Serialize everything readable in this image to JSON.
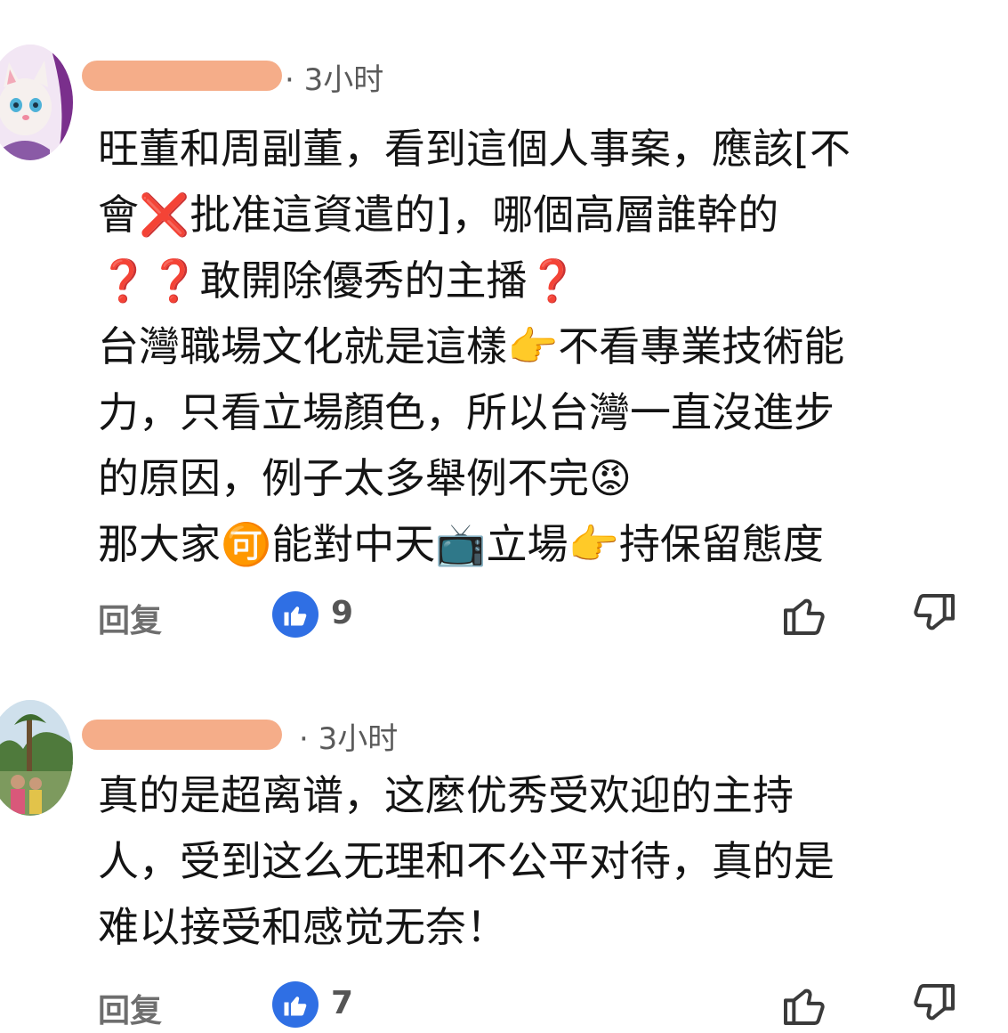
{
  "comments": [
    {
      "time_sep": "·",
      "time": "3小时",
      "body": "旺董和周副董，看到這個人事案，應該[不\n會❌批准這資遣的]，哪個高層誰幹的\n❓❓敢開除優秀的主播❓\n台灣職場文化就是這樣👉不看專業技術能\n力，只看立場顏色，所以台灣一直沒進步\n的原因，例子太多舉例不完😡\n那大家🉑能對中天📺立場👉持保留態度",
      "reply_label": "回复",
      "likes": "9"
    },
    {
      "time_sep": "·",
      "time": "3小时",
      "body": "真的是超离谱，这麼优秀受欢迎的主持\n人，受到这么无理和不公平对待，真的是\n难以接受和感觉无奈！",
      "reply_label": "回复",
      "likes": "7"
    }
  ],
  "colors": {
    "redaction": "#f4a47c",
    "like_badge": "#2f6fe4",
    "meta_text": "#5a5a5a"
  },
  "icons": {
    "like_badge": "thumbs-up-icon",
    "like_button": "thumbs-up-outline-icon",
    "dislike_button": "thumbs-down-outline-icon"
  }
}
